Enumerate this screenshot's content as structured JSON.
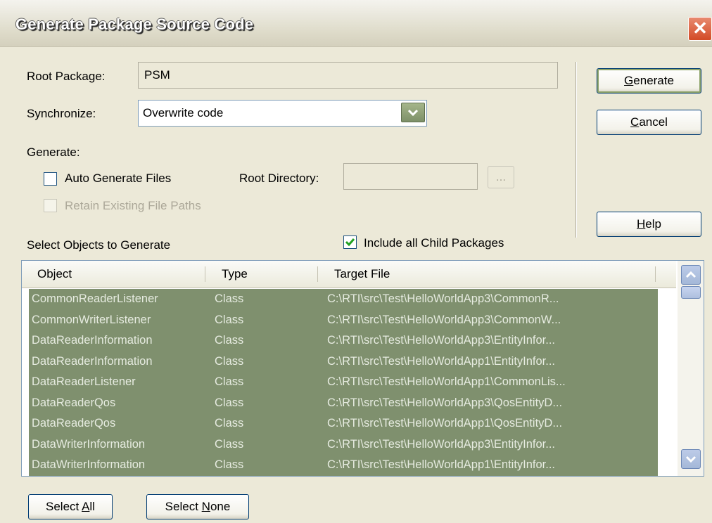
{
  "window": {
    "title": "Generate Package Source Code",
    "close_icon": "close-icon"
  },
  "root_package": {
    "label": "Root Package:",
    "value": "PSM"
  },
  "synchronize": {
    "label": "Synchronize:",
    "selected": "Overwrite code"
  },
  "generate_group": {
    "label": "Generate:",
    "auto_generate_label": "Auto Generate Files",
    "auto_generate_checked": false,
    "retain_paths_label": "Retain Existing File Paths",
    "root_directory_label": "Root Directory:",
    "root_directory_value": "",
    "browse_label": "..."
  },
  "buttons": {
    "generate_mnemonic": "G",
    "generate_rest": "enerate",
    "cancel_mnemonic": "C",
    "cancel_rest": "ancel",
    "help_mnemonic": "H",
    "help_rest": "elp",
    "select_all_prefix": "Select ",
    "select_all_mnemonic": "A",
    "select_all_rest": "ll",
    "select_none_prefix": "Select ",
    "select_none_mnemonic": "N",
    "select_none_rest": "one"
  },
  "objects": {
    "label": "Select Objects to Generate",
    "include_children_label": "Include all Child Packages",
    "include_children_checked": true,
    "columns": [
      "Object",
      "Type",
      "Target File"
    ],
    "rows": [
      [
        "CommonReaderListener",
        "Class",
        "C:\\RTI\\src\\Test\\HelloWorldApp3\\CommonR..."
      ],
      [
        "CommonWriterListener",
        "Class",
        "C:\\RTI\\src\\Test\\HelloWorldApp3\\CommonW..."
      ],
      [
        "DataReaderInformation",
        "Class",
        "C:\\RTI\\src\\Test\\HelloWorldApp3\\EntityInfor..."
      ],
      [
        "DataReaderInformation",
        "Class",
        "C:\\RTI\\src\\Test\\HelloWorldApp1\\EntityInfor..."
      ],
      [
        "DataReaderListener",
        "Class",
        "C:\\RTI\\src\\Test\\HelloWorldApp1\\CommonLis..."
      ],
      [
        "DataReaderQos",
        "Class",
        "C:\\RTI\\src\\Test\\HelloWorldApp3\\QosEntityD..."
      ],
      [
        "DataReaderQos",
        "Class",
        "C:\\RTI\\src\\Test\\HelloWorldApp1\\QosEntityD..."
      ],
      [
        "DataWriterInformation",
        "Class",
        "C:\\RTI\\src\\Test\\HelloWorldApp3\\EntityInfor..."
      ],
      [
        "DataWriterInformation",
        "Class",
        "C:\\RTI\\src\\Test\\HelloWorldApp1\\EntityInfor..."
      ]
    ]
  },
  "colors": {
    "selection": "#7f906e",
    "dialog_bg": "#ece9d8",
    "accent_green": "#8ea46a"
  }
}
